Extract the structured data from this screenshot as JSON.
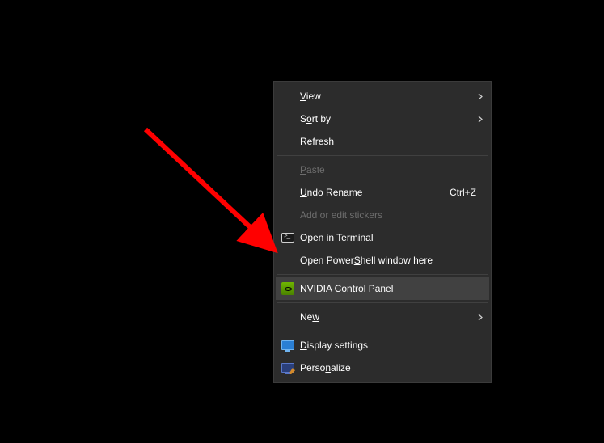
{
  "menu": {
    "items": [
      {
        "key": "view",
        "pre": "",
        "u": "V",
        "post": "iew",
        "submenu": true
      },
      {
        "key": "sort-by",
        "pre": "S",
        "u": "o",
        "post": "rt by",
        "submenu": true
      },
      {
        "key": "refresh",
        "pre": "R",
        "u": "e",
        "post": "fresh"
      }
    ],
    "paste": {
      "pre": "",
      "u": "P",
      "post": "aste"
    },
    "undo_rename": {
      "pre": "",
      "u": "U",
      "post": "ndo Rename",
      "shortcut": "Ctrl+Z"
    },
    "stickers": {
      "label": "Add or edit stickers"
    },
    "open_terminal": {
      "label": "Open in Terminal"
    },
    "open_powershell": {
      "pre": "Open Power",
      "u": "S",
      "post": "hell window here"
    },
    "nvidia": {
      "label": "NVIDIA Control Panel"
    },
    "new": {
      "pre": "Ne",
      "u": "w",
      "post": "",
      "submenu": true
    },
    "display_settings": {
      "pre": "",
      "u": "D",
      "post": "isplay settings"
    },
    "personalize": {
      "pre": "Perso",
      "u": "n",
      "post": "alize"
    }
  },
  "annotation": {
    "arrow_color": "#ff0000"
  }
}
